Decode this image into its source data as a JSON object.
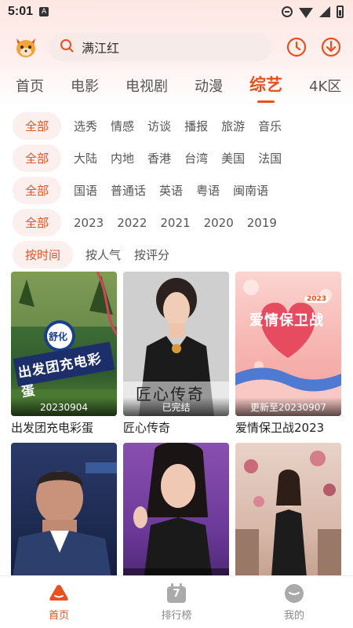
{
  "status_bar": {
    "time": "5:01",
    "app_indicator": "A"
  },
  "search": {
    "placeholder": "满江红"
  },
  "tabs": [
    {
      "label": "首页",
      "active": false
    },
    {
      "label": "电影",
      "active": false
    },
    {
      "label": "电视剧",
      "active": false
    },
    {
      "label": "动漫",
      "active": false
    },
    {
      "label": "综艺",
      "active": true
    },
    {
      "label": "4K区",
      "active": false
    }
  ],
  "filters": {
    "genre": [
      "全部",
      "选秀",
      "情感",
      "访谈",
      "播报",
      "旅游",
      "音乐"
    ],
    "region": [
      "全部",
      "大陆",
      "内地",
      "香港",
      "台湾",
      "美国",
      "法国"
    ],
    "language": [
      "全部",
      "国语",
      "普通话",
      "英语",
      "粤语",
      "闽南语"
    ],
    "year": [
      "全部",
      "2023",
      "2022",
      "2021",
      "2020",
      "2019"
    ],
    "sort": [
      "按时间",
      "按人气",
      "按评分"
    ]
  },
  "cards": [
    {
      "title": "出发团充电彩蛋",
      "badge": "20230904",
      "poster_text": "出发团充电彩蛋",
      "poster_logo": "舒化"
    },
    {
      "title": "匠心传奇",
      "badge": "已完结",
      "poster_text": "匠心传奇"
    },
    {
      "title": "爱情保卫战2023",
      "badge": "更新至20230907",
      "poster_text": "爱情保卫战",
      "poster_year": "2023"
    },
    {
      "title": "",
      "badge": ""
    },
    {
      "title": "",
      "badge": ""
    },
    {
      "title": "",
      "badge": ""
    }
  ],
  "bottom_nav": [
    {
      "label": "首页",
      "icon": "home-icon",
      "active": true
    },
    {
      "label": "排行榜",
      "icon": "ranking-icon",
      "badge_num": "7",
      "active": false
    },
    {
      "label": "我的",
      "icon": "profile-icon",
      "active": false
    }
  ],
  "colors": {
    "accent": "#e8501f",
    "chip_bg": "#fbf0ee",
    "search_bg": "#f6ebe8"
  }
}
